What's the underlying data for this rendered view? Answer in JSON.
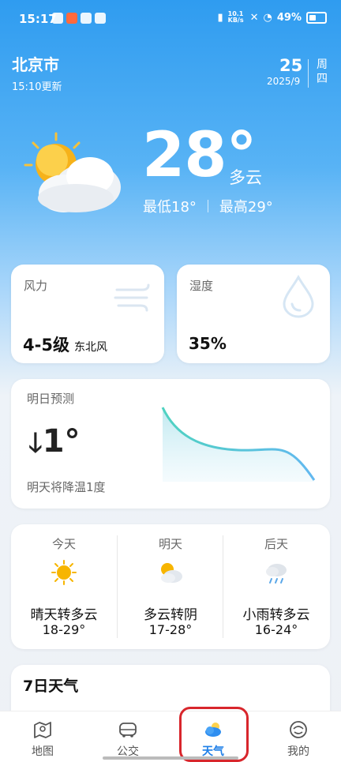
{
  "status_bar": {
    "time": "15:17",
    "net_speed": "10.1 KB/s",
    "battery": "49%"
  },
  "location": {
    "city": "北京市",
    "updated": "15:10更新"
  },
  "date": {
    "day": "25",
    "year_month": "2025/9",
    "weekday": "周四"
  },
  "current": {
    "temp": "28°",
    "condition": "多云",
    "low": "最低18°",
    "high": "最高29°"
  },
  "wind": {
    "label": "风力",
    "level": "4-5级",
    "direction": "东北风"
  },
  "humidity": {
    "label": "湿度",
    "value": "35%"
  },
  "tomorrow": {
    "title": "明日预测",
    "delta": "1°",
    "note": "明天将降温1度"
  },
  "forecast": [
    {
      "day": "今天",
      "icon": "sun-icon",
      "condition": "晴天转多云",
      "temp": "18-29°"
    },
    {
      "day": "明天",
      "icon": "partly-cloudy-icon",
      "condition": "多云转阴",
      "temp": "17-28°"
    },
    {
      "day": "后天",
      "icon": "rain-cloud-icon",
      "condition": "小雨转多云",
      "temp": "16-24°"
    }
  ],
  "seven_day": {
    "title": "7日天气"
  },
  "tabs": [
    {
      "label": "地图",
      "icon": "map-icon"
    },
    {
      "label": "公交",
      "icon": "bus-icon"
    },
    {
      "label": "天气",
      "icon": "weather-icon"
    },
    {
      "label": "我的",
      "icon": "profile-icon"
    }
  ],
  "colors": {
    "accent": "#1f7fe8",
    "highlight": "#d8262c",
    "sky_top": "#2f9cf0",
    "sun": "#f7b500"
  }
}
